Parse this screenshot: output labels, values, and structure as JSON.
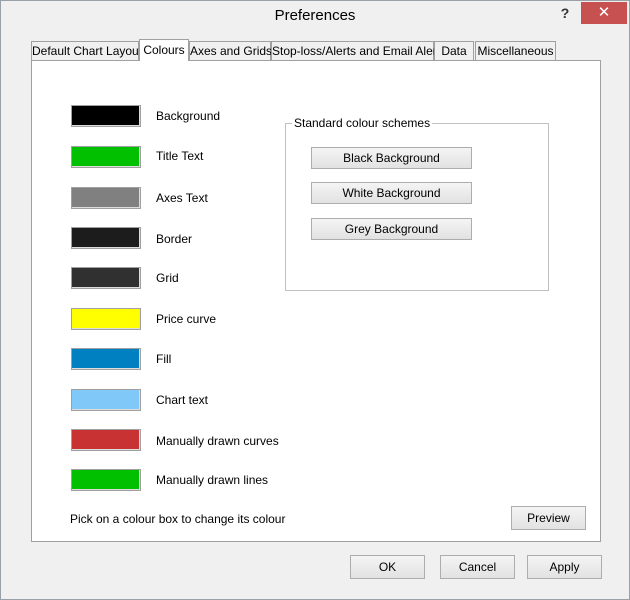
{
  "window": {
    "title": "Preferences",
    "help_label": "?",
    "close_label": "✕"
  },
  "tabs": [
    {
      "label": "Default Chart Layout"
    },
    {
      "label": "Colours"
    },
    {
      "label": "Axes and Grids"
    },
    {
      "label": "Stop-loss/Alerts and Email Alerts"
    },
    {
      "label": "Data"
    },
    {
      "label": "Miscellaneous"
    }
  ],
  "colours": [
    {
      "label": "Background",
      "color": "#000000"
    },
    {
      "label": "Title Text",
      "color": "#00c000"
    },
    {
      "label": "Axes Text",
      "color": "#808080"
    },
    {
      "label": "Border",
      "color": "#1c1c1c"
    },
    {
      "label": "Grid",
      "color": "#303030"
    },
    {
      "label": "Price curve",
      "color": "#ffff00"
    },
    {
      "label": "Fill",
      "color": "#0080c0"
    },
    {
      "label": "Chart text",
      "color": "#80c8f8"
    },
    {
      "label": "Manually drawn curves",
      "color": "#c83232"
    },
    {
      "label": "Manually drawn lines",
      "color": "#00c000"
    }
  ],
  "schemes": {
    "title": "Standard colour schemes",
    "buttons": [
      "Black Background",
      "White Background",
      "Grey Background"
    ]
  },
  "hint": "Pick on a colour box to change its colour",
  "preview_label": "Preview",
  "dialog_buttons": {
    "ok": "OK",
    "cancel": "Cancel",
    "apply": "Apply"
  }
}
